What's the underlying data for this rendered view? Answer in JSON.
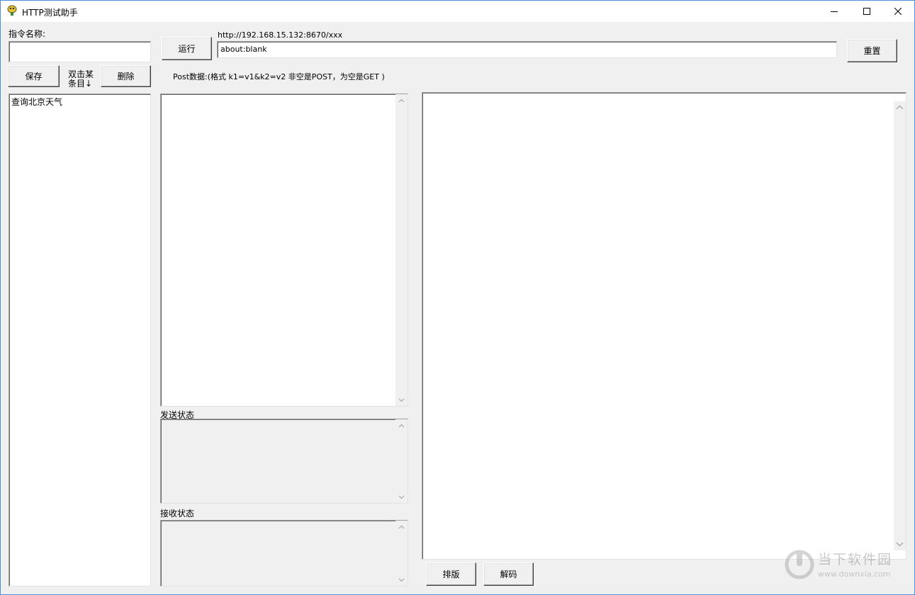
{
  "window": {
    "title": "HTTP测试助手",
    "icon": "app-logo-icon"
  },
  "command": {
    "name_label": "指令名称:",
    "name_value": "",
    "save_label": "保存",
    "double_click_hint": "双击某条目↓",
    "delete_label": "删除",
    "list_items": [
      "查询北京天气"
    ]
  },
  "request": {
    "run_label": "运行",
    "url_hint": "http://192.168.15.132:8670/xxx",
    "url_value": "about:blank",
    "reset_label": "重置",
    "post_hint": "Post数据:(格式 k1=v1&k2=v2 非空是POST，为空是GET )",
    "post_value": ""
  },
  "status": {
    "send_label": "发送状态",
    "send_value": "",
    "receive_label": "接收状态",
    "receive_value": ""
  },
  "response": {
    "body": "",
    "format_label": "排版",
    "decode_label": "解码"
  },
  "watermark": {
    "brand": "当下软件园",
    "url": "www.downxia.com"
  },
  "colors": {
    "window_border": "#4a90d9",
    "background": "#f0f0f0"
  }
}
